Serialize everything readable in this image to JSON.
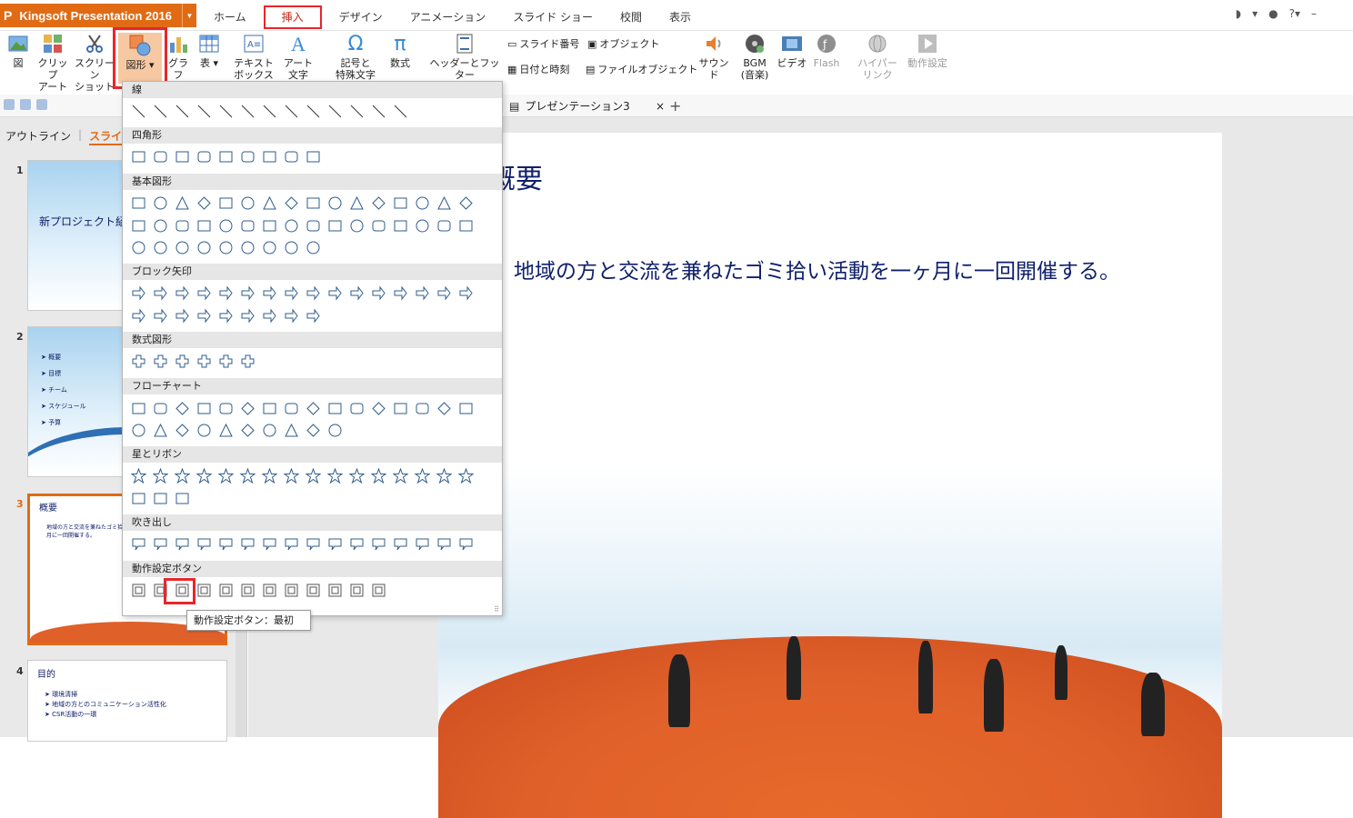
{
  "app": {
    "title": "Kingsoft Presentation 2016",
    "accent": "#e06b14"
  },
  "menu_tabs": [
    "ホーム",
    "挿入",
    "デザイン",
    "アニメーション",
    "スライド ショー",
    "校閲",
    "表示"
  ],
  "ribbon": {
    "picture": "図",
    "clipart": [
      "クリップ",
      "アート"
    ],
    "screenshot": [
      "スクリーン",
      "ショット"
    ],
    "shapes": "図形",
    "chart": "グラフ",
    "table": "表",
    "textbox": [
      "テキスト",
      "ボックス"
    ],
    "wordart": [
      "アート",
      "文字"
    ],
    "symbol": [
      "記号と",
      "特殊文字"
    ],
    "equation": "数式",
    "header_footer": "ヘッダーとフッター",
    "slide_number": "スライド番号",
    "object": "オブジェクト",
    "datetime": "日付と時刻",
    "file_object": "ファイルオブジェクト",
    "sound": "サウンド",
    "bgm": [
      "BGM",
      "(音楽)"
    ],
    "video": "ビデオ",
    "flash": "Flash",
    "hyperlink": [
      "ハイパー",
      "リンク"
    ],
    "action": "動作設定"
  },
  "doc_tab": {
    "name": "プレゼンテーション3",
    "close": "×",
    "new": "+"
  },
  "left_tabs": {
    "outline": "アウトライン",
    "slides": "スライド"
  },
  "slides": [
    {
      "num": "1",
      "title": "新プロジェクト紹"
    },
    {
      "num": "2",
      "items": [
        "概要",
        "目標",
        "チーム",
        "スケジュール",
        "予算"
      ]
    },
    {
      "num": "3",
      "title": "概要",
      "body": "地域の方と交流を兼ねたゴミ拾い活動を一ヶ月に一回開催する。"
    },
    {
      "num": "4",
      "title": "目的",
      "items": [
        "環境清掃",
        "地域の方とのコミュニケーション活性化",
        "CSR活動の一環"
      ]
    }
  ],
  "current_slide": {
    "title": "概要",
    "body": "地域の方と交流を兼ねたゴミ拾い活動を一ヶ月に一回開催する。"
  },
  "shapes_menu": {
    "sections": [
      "線",
      "四角形",
      "基本図形",
      "ブロック矢印",
      "数式図形",
      "フローチャート",
      "星とリボン",
      "吹き出し",
      "動作設定ボタン"
    ],
    "tooltip": "動作設定ボタン：最初"
  }
}
